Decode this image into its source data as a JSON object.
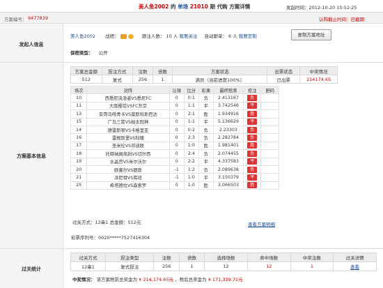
{
  "header": {
    "author": "美人鱼2002",
    "text1": "的",
    "sport": "单场",
    "issue": "21010",
    "text2": "期",
    "text3": "代购",
    "text4": "方案详情",
    "time_label": "发起时间：",
    "time": "2012-10-20 15:52:25"
  },
  "plan": {
    "no_label": "方案编号：",
    "no": "9477839",
    "end_note": "认购截止时间：已截期"
  },
  "sections": {
    "initiator": "发起人信息",
    "basic": "方案基本信息",
    "pass": "过关统计"
  },
  "initiator": {
    "name": "美人鱼2002",
    "record_label": "战绩：",
    "follow_label": "跟注人数：",
    "follow_count": "10 人",
    "follow_link": "我要关注",
    "auto_label": "自动跟单：",
    "auto_count": "6 人",
    "auto_link": "我要定制",
    "copy_button": "复制方案地址",
    "secrecy_label": "保密类型：",
    "secrecy_value": "公开"
  },
  "summary": {
    "headers": [
      "方案总金额",
      "投注方式",
      "注数",
      "倍数",
      "方案状态",
      "出票状态",
      "中奖情况"
    ],
    "row": [
      "512",
      "复式",
      "256",
      "1",
      "满员（当前进度100%）",
      "已出票",
      "214174.65"
    ]
  },
  "matches": {
    "headers": [
      "场次",
      "对阵",
      "让球",
      "比分",
      "彩果",
      "最终赔率",
      "投注",
      "胆码"
    ],
    "rows": [
      [
        "10",
        "西悉尼流浪者VS悉尼FC",
        "0",
        "0:1",
        "负",
        "2.413167",
        "负",
        ""
      ],
      [
        "11",
        "大阪樱花VSFC东京",
        "0",
        "1:1",
        "平",
        "3.742546",
        "平",
        ""
      ],
      [
        "13",
        "安哥马哈青卡VS莫斯科斯巴达",
        "0",
        "2:1",
        "胜",
        "1.934916",
        "胜",
        ""
      ],
      [
        "15",
        "广岛三箭VS柏太阳神",
        "0",
        "1:1",
        "平",
        "5.136629",
        "平",
        ""
      ],
      [
        "14",
        "德雷斯顿VS卡格里亚",
        "0",
        "0:2",
        "负",
        "2.23303",
        "负",
        ""
      ],
      [
        "16",
        "雷根斯堡VS科隆",
        "0",
        "2:3",
        "负",
        "2.282784",
        "负",
        ""
      ],
      [
        "17",
        "圣米伦VS邓迪联",
        "0",
        "1:0",
        "胜",
        "1.981401",
        "胜",
        ""
      ],
      [
        "18",
        "托特纳姆热刺VS切尔西",
        "0",
        "2:4",
        "负",
        "2.074455",
        "负",
        ""
      ],
      [
        "19",
        "水晶宫VS米尔沃尔",
        "0",
        "2:2",
        "平",
        "4.337583",
        "平",
        ""
      ],
      [
        "20",
        "欧塞尔VS朗斯",
        "-1",
        "1:2",
        "负",
        "2.089638",
        "负",
        ""
      ],
      [
        "21",
        "泽尼特VS库班",
        "-1",
        "1:0",
        "平",
        "3.150379",
        "平",
        ""
      ],
      [
        "25",
        "希塔德拉VS森索罗",
        "0",
        "1:0",
        "胜",
        "3.066503",
        "胜",
        ""
      ]
    ],
    "pass_info": "过关方式：12串1  总金额：512元",
    "detail_link": "查看方案明细",
    "ticket_label": "彩票序列号：",
    "ticket_no": "0020*****7527416304"
  },
  "pass_stats": {
    "headers": [
      "过关方式",
      "投注类型",
      "注数",
      "倍数",
      "选择场数",
      "命中场数",
      "中奖注数",
      "过关详情"
    ],
    "row": [
      "12串1",
      "复式投注",
      "256",
      "1",
      "12",
      "12",
      "1",
      "查看"
    ],
    "win_label": "中奖情况：",
    "win_text": "该方案税前总奖金为",
    "win_pre": "¥ 214,174.65元",
    "win_mid": "，税后总奖金为",
    "win_post": "¥ 171,339.72元"
  },
  "colors": {
    "accent_red": "#cc0000",
    "link_blue": "#1a4e9c",
    "tag_red": "#dd3333"
  }
}
